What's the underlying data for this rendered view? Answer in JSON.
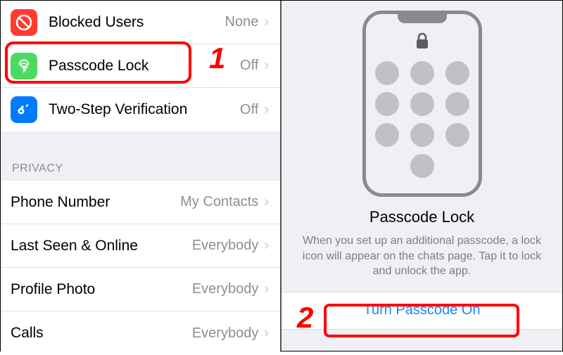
{
  "left": {
    "security_rows": [
      {
        "id": "blocked",
        "label": "Blocked Users",
        "value": "None",
        "icon": "blocked-icon",
        "icon_bg": "ic-red"
      },
      {
        "id": "passcode",
        "label": "Passcode Lock",
        "value": "Off",
        "icon": "fingerprint-icon",
        "icon_bg": "ic-green"
      },
      {
        "id": "twostep",
        "label": "Two-Step Verification",
        "value": "Off",
        "icon": "key-icon",
        "icon_bg": "ic-blue"
      }
    ],
    "privacy_header": "PRIVACY",
    "privacy_rows": [
      {
        "id": "phone",
        "label": "Phone Number",
        "value": "My Contacts"
      },
      {
        "id": "lastseen",
        "label": "Last Seen & Online",
        "value": "Everybody"
      },
      {
        "id": "photo",
        "label": "Profile Photo",
        "value": "Everybody"
      },
      {
        "id": "calls",
        "label": "Calls",
        "value": "Everybody"
      }
    ]
  },
  "right": {
    "title": "Passcode Lock",
    "description": "When you set up an additional passcode, a lock icon will appear on the chats page. Tap it to lock and unlock the app.",
    "button": "Turn Passcode On"
  },
  "annotations": {
    "step1": "1",
    "step2": "2"
  }
}
